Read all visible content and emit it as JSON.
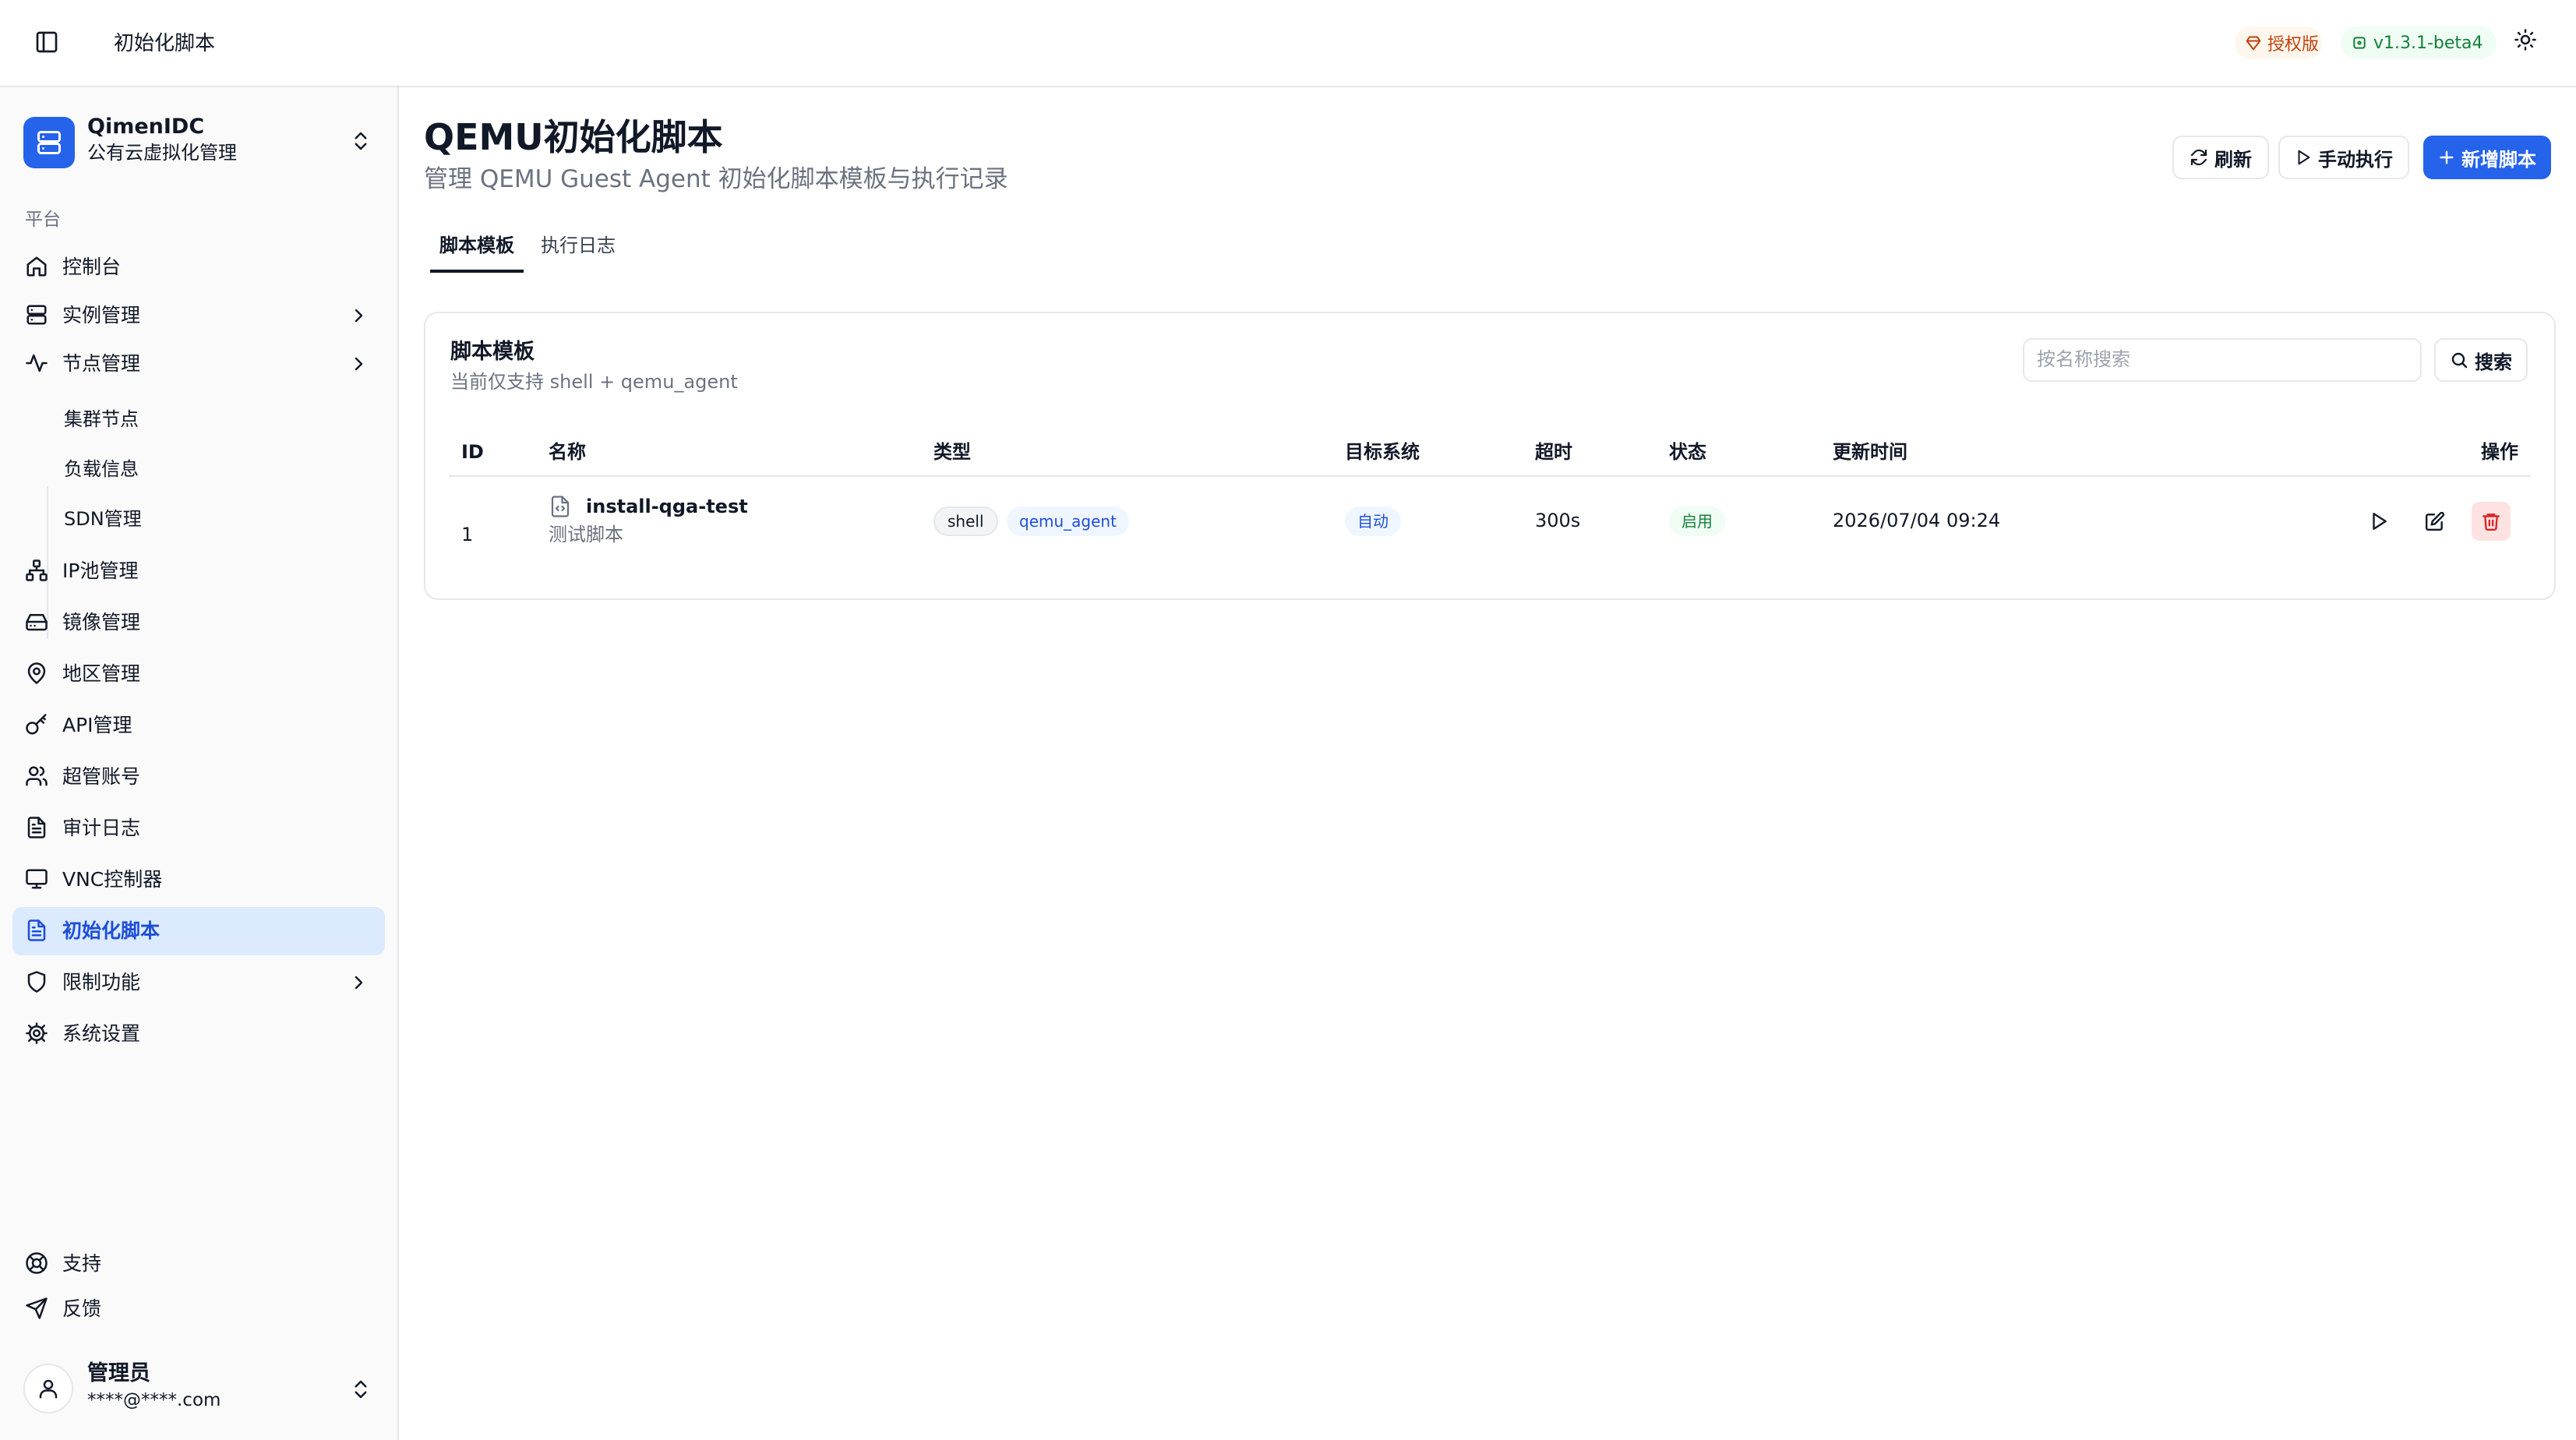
{
  "topbar": {
    "breadcrumb": "初始化脚本",
    "license_badge": "授权版",
    "version_badge": "v1.3.1-beta4"
  },
  "sidebar": {
    "org_name": "QimenIDC",
    "org_subtitle": "公有云虚拟化管理",
    "group_label": "平台",
    "items": [
      {
        "label": "控制台",
        "icon": "home-icon"
      },
      {
        "label": "实例管理",
        "icon": "server-icon"
      },
      {
        "label": "节点管理",
        "icon": "activity-icon"
      },
      {
        "label": "集群节点"
      },
      {
        "label": "负载信息"
      },
      {
        "label": "SDN管理"
      },
      {
        "label": "IP池管理",
        "icon": "network-icon"
      },
      {
        "label": "镜像管理",
        "icon": "hard-drive-icon"
      },
      {
        "label": "地区管理",
        "icon": "map-pin-icon"
      },
      {
        "label": "API管理",
        "icon": "key-icon"
      },
      {
        "label": "超管账号",
        "icon": "users-icon"
      },
      {
        "label": "审计日志",
        "icon": "file-text-icon"
      },
      {
        "label": "VNC控制器",
        "icon": "monitor-icon"
      },
      {
        "label": "初始化脚本",
        "icon": "file-text-icon"
      },
      {
        "label": "限制功能",
        "icon": "shield-icon"
      },
      {
        "label": "系统设置",
        "icon": "gear-icon"
      }
    ],
    "footer": [
      {
        "label": "支持",
        "icon": "life-buoy-icon"
      },
      {
        "label": "反馈",
        "icon": "send-icon"
      }
    ],
    "user": {
      "name": "管理员",
      "email": "****@****.com"
    }
  },
  "main": {
    "title": "QEMU初始化脚本",
    "description": "管理 QEMU Guest Agent 初始化脚本模板与执行记录",
    "buttons": {
      "refresh": "刷新",
      "manual_run": "手动执行",
      "add": "新增脚本"
    },
    "tabs": [
      {
        "label": "脚本模板"
      },
      {
        "label": "执行日志"
      }
    ],
    "card": {
      "title": "脚本模板",
      "subtitle": "当前仅支持 shell + qemu_agent",
      "search_placeholder": "按名称搜索",
      "search_button": "搜索",
      "columns": [
        "ID",
        "名称",
        "类型",
        "目标系统",
        "超时",
        "状态",
        "更新时间",
        "操作"
      ],
      "rows": [
        {
          "id": "1",
          "name": "install-qga-test",
          "desc": "测试脚本",
          "type_tags": [
            "shell",
            "qemu_agent"
          ],
          "target": "自动",
          "timeout": "300s",
          "status": "启用",
          "updated": "2026/07/04 09:24"
        }
      ]
    }
  },
  "colors": {
    "accent": "#2563eb",
    "active_bg": "#dbeafe",
    "danger": "#dc2626",
    "success": "#15803d"
  }
}
